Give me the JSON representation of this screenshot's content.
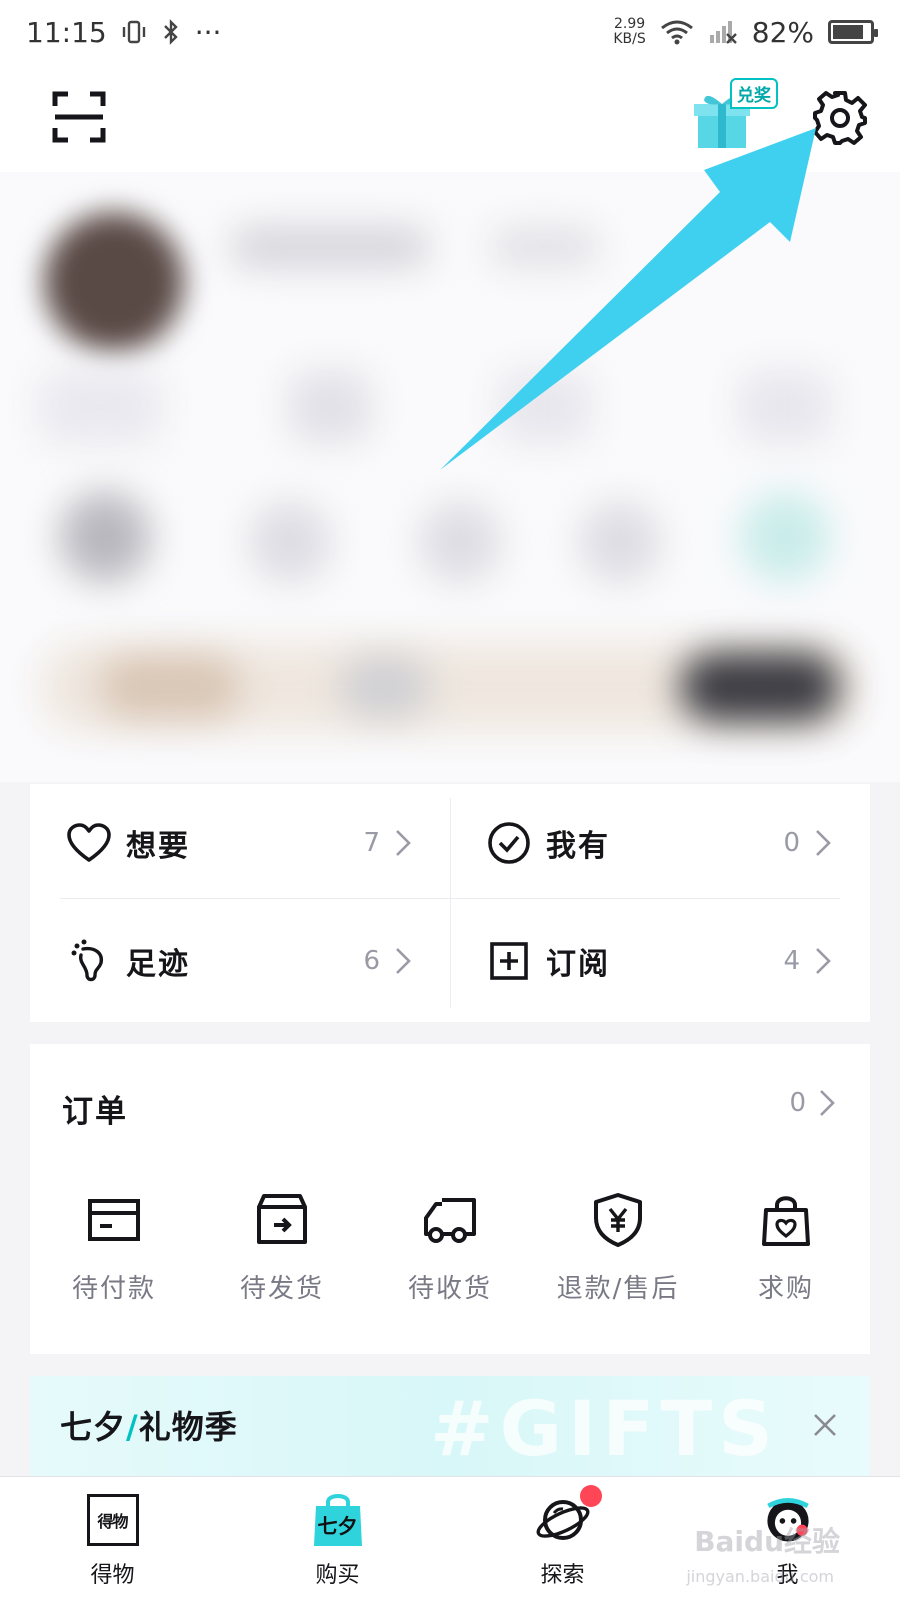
{
  "status_bar": {
    "time": "11:15",
    "more": "···",
    "speed_value": "2.99",
    "speed_unit": "KB/S",
    "battery": "82%",
    "battery_level": 0.82
  },
  "header": {
    "gift_badge": "兑奖"
  },
  "stats": {
    "want_label": "想要",
    "want_count": "7",
    "have_label": "我有",
    "have_count": "0",
    "footprint_label": "足迹",
    "footprint_count": "6",
    "subscribe_label": "订阅",
    "subscribe_count": "4"
  },
  "orders": {
    "title": "订单",
    "count": "0",
    "items": [
      {
        "label": "待付款",
        "icon": "card-icon"
      },
      {
        "label": "待发货",
        "icon": "box-icon"
      },
      {
        "label": "待收货",
        "icon": "truck-icon"
      },
      {
        "label": "退款/售后",
        "icon": "shield-yen-icon"
      },
      {
        "label": "求购",
        "icon": "heart-bag-icon"
      }
    ]
  },
  "promo": {
    "title_left": "七夕",
    "slash": "/",
    "title_right": "礼物季",
    "bg_text": "#GIFTS"
  },
  "bottom_nav": {
    "items": [
      {
        "label": "得物",
        "icon_text": "得物"
      },
      {
        "label": "购买",
        "icon_text": "七夕"
      },
      {
        "label": "探索"
      },
      {
        "label": "我"
      }
    ]
  },
  "watermark": {
    "main": "Baidu经验",
    "sub": "jingyan.baidu.com"
  },
  "colors": {
    "accent": "#01c2c3",
    "arrow": "#3fd0f0",
    "notification": "#ff4657",
    "text_primary": "#16161a",
    "text_secondary": "#9a9aa6"
  }
}
